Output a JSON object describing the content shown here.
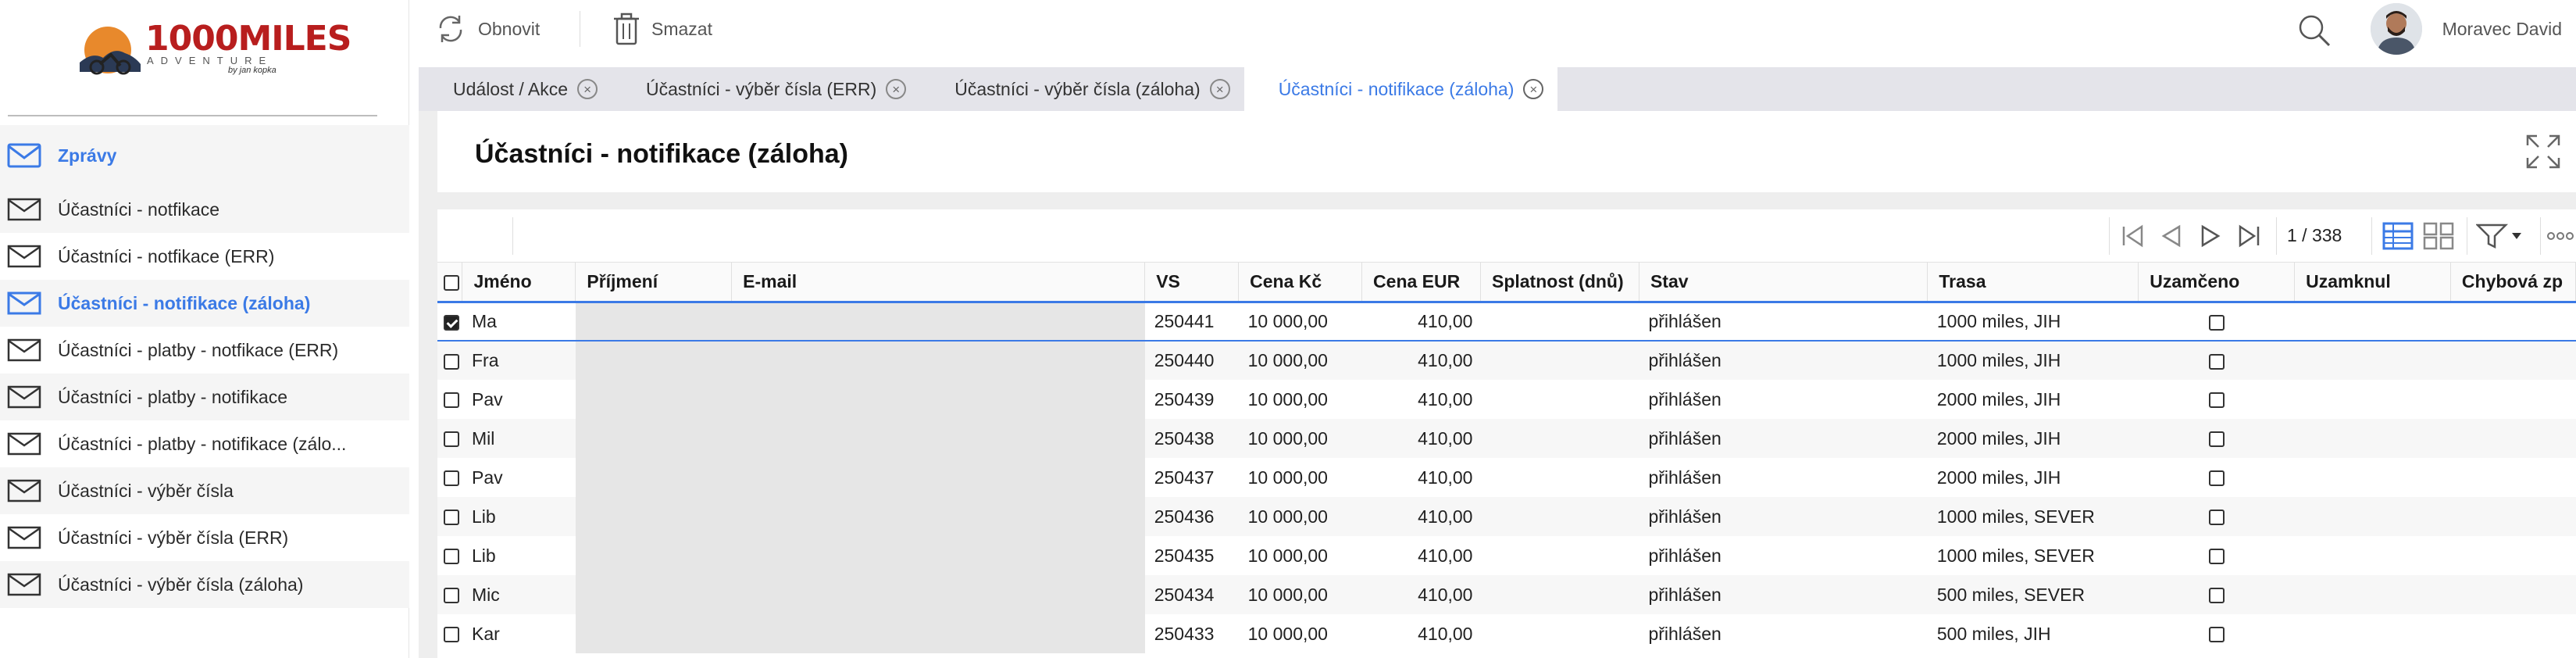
{
  "brand": {
    "logo_main": "1000MILES",
    "logo_sub": "ADVENTURE",
    "logo_by": "by jan kopka",
    "accent_color": "#3b7ae6",
    "logo_color": "#b81e1e"
  },
  "sidebar": {
    "header": {
      "label": "Zprávy",
      "icon": "mail-icon"
    },
    "items": [
      {
        "label": "Účastníci - notfikace",
        "icon": "mail-icon",
        "active": false
      },
      {
        "label": "Účastníci - notfikace (ERR)",
        "icon": "mail-icon",
        "active": false
      },
      {
        "label": "Účastníci - notifikace (záloha)",
        "icon": "mail-icon",
        "active": true
      },
      {
        "label": "Účastníci - platby - notfikace (ERR)",
        "icon": "mail-icon",
        "active": false
      },
      {
        "label": "Účastníci - platby - notifikace",
        "icon": "mail-icon",
        "active": false
      },
      {
        "label": "Účastníci - platby - notifikace (zálo...",
        "icon": "mail-icon",
        "active": false
      },
      {
        "label": "Účastníci - výběr čísla",
        "icon": "mail-icon",
        "active": false
      },
      {
        "label": "Účastníci - výběr čísla (ERR)",
        "icon": "mail-icon",
        "active": false
      },
      {
        "label": "Účastníci - výběr čísla (záloha)",
        "icon": "mail-icon",
        "active": false
      }
    ]
  },
  "toolbar": {
    "refresh_label": "Obnovit",
    "delete_label": "Smazat"
  },
  "user": {
    "name": "Moravec David"
  },
  "tabs": [
    {
      "label": "Událost / Akce",
      "active": false
    },
    {
      "label": "Účastníci - výběr čísla (ERR)",
      "active": false
    },
    {
      "label": "Účastníci - výběr čísla (záloha)",
      "active": false
    },
    {
      "label": "Účastníci - notifikace (záloha)",
      "active": true
    }
  ],
  "page": {
    "title": "Účastníci - notifikace (záloha)"
  },
  "grid": {
    "page_info": "1 / 338",
    "columns": [
      "Jméno",
      "Příjmení",
      "E-mail",
      "VS",
      "Cena Kč",
      "Cena EUR",
      "Splatnost (dnů)",
      "Stav",
      "Trasa",
      "Uzamčeno",
      "Uzamknul",
      "Chybová zp"
    ],
    "rows": [
      {
        "jmeno": "Ma",
        "vs": "250441",
        "cena_kc": "10 000,00",
        "cena_eur": "410,00",
        "stav": "přihlášen",
        "trasa": "1000 miles, JIH",
        "checked": true
      },
      {
        "jmeno": "Fra",
        "vs": "250440",
        "cena_kc": "10 000,00",
        "cena_eur": "410,00",
        "stav": "přihlášen",
        "trasa": "1000 miles, JIH",
        "checked": false
      },
      {
        "jmeno": "Pav",
        "vs": "250439",
        "cena_kc": "10 000,00",
        "cena_eur": "410,00",
        "stav": "přihlášen",
        "trasa": "2000 miles, JIH",
        "checked": false
      },
      {
        "jmeno": "Mil",
        "vs": "250438",
        "cena_kc": "10 000,00",
        "cena_eur": "410,00",
        "stav": "přihlášen",
        "trasa": "2000 miles, JIH",
        "checked": false
      },
      {
        "jmeno": "Pav",
        "vs": "250437",
        "cena_kc": "10 000,00",
        "cena_eur": "410,00",
        "stav": "přihlášen",
        "trasa": "2000 miles, JIH",
        "checked": false
      },
      {
        "jmeno": "Lib",
        "vs": "250436",
        "cena_kc": "10 000,00",
        "cena_eur": "410,00",
        "stav": "přihlášen",
        "trasa": "1000 miles, SEVER",
        "checked": false
      },
      {
        "jmeno": "Lib",
        "vs": "250435",
        "cena_kc": "10 000,00",
        "cena_eur": "410,00",
        "stav": "přihlášen",
        "trasa": "1000 miles, SEVER",
        "checked": false
      },
      {
        "jmeno": "Mic",
        "vs": "250434",
        "cena_kc": "10 000,00",
        "cena_eur": "410,00",
        "stav": "přihlášen",
        "trasa": "500 miles, SEVER",
        "checked": false
      },
      {
        "jmeno": "Kar",
        "vs": "250433",
        "cena_kc": "10 000,00",
        "cena_eur": "410,00",
        "stav": "přihlášen",
        "trasa": "500 miles, JIH",
        "checked": false
      }
    ]
  }
}
